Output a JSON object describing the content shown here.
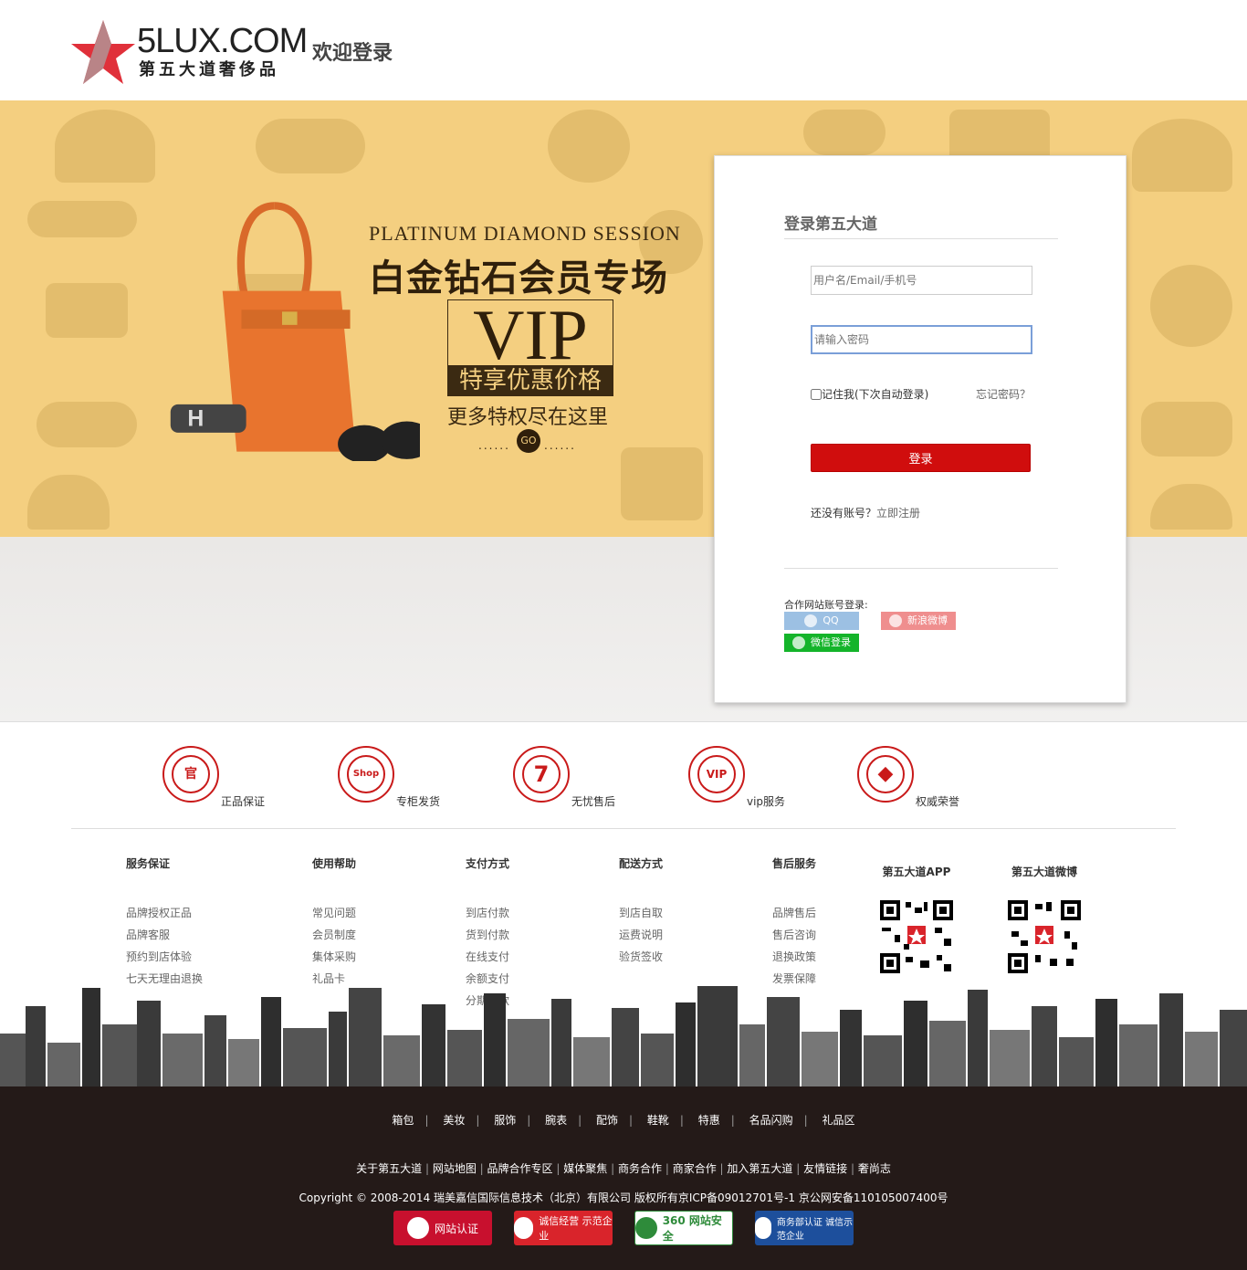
{
  "header": {
    "logo_text": "5LUX.COM",
    "logo_sub": "第五大道奢侈品",
    "welcome": "欢迎登录"
  },
  "banner": {
    "promo_en": "PLATINUM DIAMOND SESSION",
    "promo_cn": "白金钻石会员专场",
    "vip": "VIP",
    "tag": "特享优惠价格",
    "more": "更多特权尽在这里",
    "go": "GO",
    "go_dots_left": "......",
    "go_dots_right": "......"
  },
  "login": {
    "title": "登录第五大道",
    "username_placeholder": "用户名/Email/手机号",
    "password_placeholder": "请输入密码",
    "remember": "记住我(下次自动登录)",
    "forgot": "忘记密码？",
    "submit": "登录",
    "no_account": "还没有账号？",
    "register": "立即注册",
    "partner": "合作网站账号登录:",
    "qq": "QQ",
    "weibo": "新浪微博",
    "wechat": "微信登录"
  },
  "services": [
    {
      "label": "正品保证",
      "icon": "官"
    },
    {
      "label": "专柜发货",
      "icon": "Shop"
    },
    {
      "label": "无忧售后",
      "icon": "7"
    },
    {
      "label": "vip服务",
      "icon": "VIP"
    },
    {
      "label": "权威荣誉",
      "icon": "◆"
    }
  ],
  "footer_columns": [
    {
      "title": "服务保证",
      "items": [
        "品牌授权正品",
        "品牌客服",
        "预约到店体验",
        "七天无理由退换"
      ]
    },
    {
      "title": "使用帮助",
      "items": [
        "常见问题",
        "会员制度",
        "集体采购",
        "礼品卡"
      ]
    },
    {
      "title": "支付方式",
      "items": [
        "到店付款",
        "货到付款",
        "在线支付",
        "余额支付",
        "分期付款"
      ]
    },
    {
      "title": "配送方式",
      "items": [
        "到店自取",
        "运费说明",
        "验货签收"
      ]
    },
    {
      "title": "售后服务",
      "items": [
        "品牌售后",
        "售后咨询",
        "退换政策",
        "发票保障"
      ]
    }
  ],
  "qr": [
    {
      "title": "第五大道APP"
    },
    {
      "title": "第五大道微博"
    }
  ],
  "nav1": [
    "箱包",
    "美妆",
    "服饰",
    "腕表",
    "配饰",
    "鞋靴",
    "特惠",
    "名品闪购",
    "礼品区"
  ],
  "nav2": [
    "关于第五大道",
    "网站地图",
    "品牌合作专区",
    "媒体聚焦",
    "商务合作",
    "商家合作",
    "加入第五大道",
    "友情链接",
    "奢尚志"
  ],
  "copyright": "Copyright © 2008-2014 瑞美嘉信国际信息技术（北京）有限公司 版权所有京ICP备09012701号-1 京公网安备110105007400号",
  "badges": [
    {
      "text": "网站认证",
      "bg": "#c8102e",
      "fg": "#ffffff"
    },
    {
      "text": "诚信经营 示范企业",
      "bg": "#d9242b",
      "fg": "#ffffff"
    },
    {
      "text": "360 网站安全",
      "bg": "#ffffff",
      "fg": "#2e8b3a"
    },
    {
      "text": "商务部认证 诚信示范企业",
      "bg": "#1d4f9c",
      "fg": "#ffffff"
    }
  ],
  "colors": {
    "accent": "#d00d0d",
    "banner": "#f4cf80",
    "footer_dark": "#241a18"
  }
}
